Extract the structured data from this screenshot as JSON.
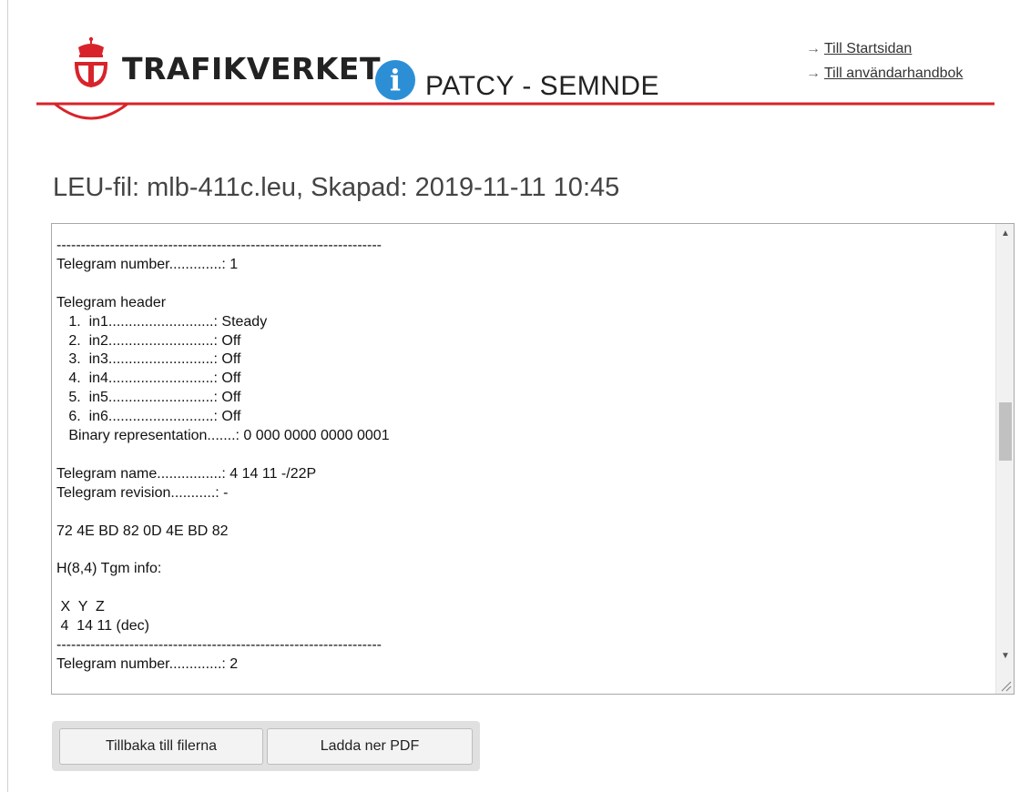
{
  "header": {
    "brand": "TRAFIKVERKET",
    "info_icon_glyph": "i",
    "app_title": "PATCY - SEMNDE",
    "links": [
      {
        "label": "Till Startsidan"
      },
      {
        "label": "Till användarhandbok"
      }
    ],
    "brand_color": "#d8232a",
    "info_color": "#2c8fd6"
  },
  "page": {
    "title": "LEU-fil: mlb-411c.leu, Skapad: 2019-11-11 10:45"
  },
  "textbox": {
    "content": "-------------------------------------------------------------------\nTelegram number.............: 1\n\nTelegram header\n   1.  in1..........................: Steady\n   2.  in2..........................: Off\n   3.  in3..........................: Off\n   4.  in4..........................: Off\n   5.  in5..........................: Off\n   6.  in6..........................: Off\n   Binary representation.......: 0 000 0000 0000 0001\n\nTelegram name................: 4 14 11 -/22P\nTelegram revision...........: -\n\n72 4E BD 82 0D 4E BD 82\n\nH(8,4) Tgm info:\n\n X  Y  Z\n 4  14 11 (dec)\n-------------------------------------------------------------------\nTelegram number.............: 2"
  },
  "buttons": {
    "back_label": "Tillbaka till filerna",
    "pdf_label": "Ladda ner PDF"
  }
}
